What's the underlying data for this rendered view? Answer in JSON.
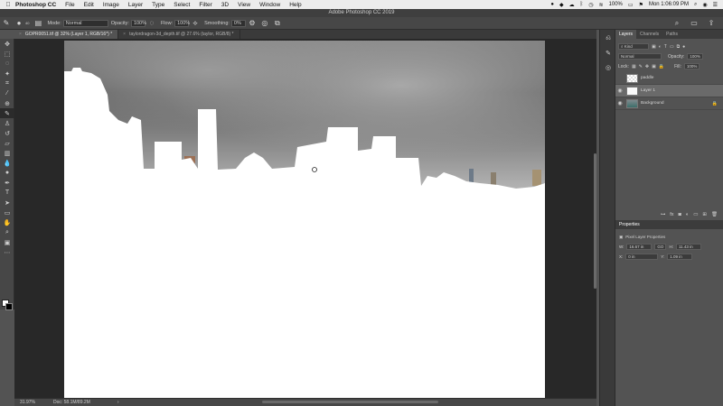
{
  "menubar": {
    "items": [
      "Photoshop CC",
      "File",
      "Edit",
      "Image",
      "Layer",
      "Type",
      "Select",
      "Filter",
      "3D",
      "View",
      "Window",
      "Help"
    ],
    "battery": "100%",
    "clock": "Mon 1:06:09 PM"
  },
  "window": {
    "title": "Adobe Photoshop CC 2019"
  },
  "options": {
    "brush_size": "40",
    "mode_label": "Mode:",
    "mode_value": "Normal",
    "opacity_label": "Opacity:",
    "opacity_value": "100%",
    "flow_label": "Flow:",
    "flow_value": "100%",
    "smoothing_label": "Smoothing:",
    "smoothing_value": "0%"
  },
  "tabs": [
    {
      "label": "GOPR0051.tif @ 32% (Layer 1, RGB/16*) *"
    },
    {
      "label": "taylordragon-3d_depth.tif @ 27.6% (taylor, RGB/8) *"
    }
  ],
  "status": {
    "zoom": "31.97%",
    "doc": "Doc: 58.1M/89.2M"
  },
  "layers_panel": {
    "tabs": [
      "Layers",
      "Channels",
      "Paths"
    ],
    "kind": "Kind",
    "blend": "Normal",
    "opacity_label": "Opacity:",
    "opacity_value": "100%",
    "lock_label": "Lock:",
    "fill_label": "Fill:",
    "fill_value": "100%",
    "layers": [
      {
        "name": "paddle"
      },
      {
        "name": "Layer 1"
      },
      {
        "name": "Background"
      }
    ]
  },
  "properties_panel": {
    "title": "Properties",
    "subtitle": "Pixel Layer Properties",
    "w_label": "W:",
    "w_value": "16.67 in",
    "go_label": "GO",
    "h_label": "H:",
    "h_value": "11.43 in",
    "x_label": "X:",
    "x_value": "0 in",
    "y_label": "Y:",
    "y_value": "1.09 in"
  }
}
